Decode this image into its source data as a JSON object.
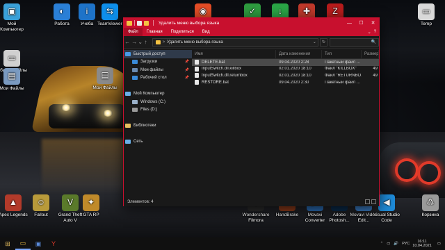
{
  "desktop_icons": [
    {
      "label": "Мой Компьютер",
      "color": "#3aa0d8",
      "glyph": "▣"
    },
    {
      "label": "Работа",
      "color": "#2a7fd6",
      "glyph": "◐"
    },
    {
      "label": "Учеба",
      "color": "#1e73c8",
      "glyph": "i"
    },
    {
      "label": "TeamViewer",
      "color": "#0e8ee9",
      "glyph": "⇆"
    },
    {
      "label": "Общие Файлы",
      "color": "#d0d0d0",
      "glyph": "▭"
    },
    {
      "label": "Мои Файлы",
      "color": "#7a9ac0",
      "glyph": "▤"
    },
    {
      "label": "",
      "color": "#e44d26",
      "glyph": "◉"
    },
    {
      "label": "",
      "color": "#2e9c3f",
      "glyph": "✓"
    },
    {
      "label": "",
      "color": "#2aa546",
      "glyph": "↓"
    },
    {
      "label": "",
      "color": "#c0392b",
      "glyph": "✚"
    },
    {
      "label": "",
      "color": "#b81c1c",
      "glyph": "Z"
    },
    {
      "label": "Temp",
      "color": "#d8d8d8",
      "glyph": "▭"
    },
    {
      "label": "Мои Файлы",
      "color": "#8a8a8a",
      "glyph": "▤"
    },
    {
      "label": "Apex Legends",
      "color": "#b23a2a",
      "glyph": "▲"
    },
    {
      "label": "Fallout",
      "color": "#b89a3a",
      "glyph": "☺"
    },
    {
      "label": "Grand Theft Auto V",
      "color": "#5a7a2a",
      "glyph": "V"
    },
    {
      "label": "GTA RP",
      "color": "#c08a2a",
      "glyph": "✦"
    },
    {
      "label": "Wondershare Filmora",
      "color": "#2a2a2a",
      "glyph": "◆"
    },
    {
      "label": "HandBrake",
      "color": "#8a3a1a",
      "glyph": "♨"
    },
    {
      "label": "Movavi Converter",
      "color": "#2a6ab0",
      "glyph": "▶"
    },
    {
      "label": "Adobe Photosh...",
      "color": "#0a2a4a",
      "glyph": "Ps"
    },
    {
      "label": "Movavi Video Edit...",
      "color": "#3a7ac0",
      "glyph": "▶"
    },
    {
      "label": "Visual Studio Code",
      "color": "#1e8ad6",
      "glyph": "◀"
    },
    {
      "label": "Корзина",
      "color": "#9a9a9a",
      "glyph": "♺"
    }
  ],
  "window": {
    "title": "Удалить меню выбора языка",
    "controls": {
      "minimize": "—",
      "maximize": "☐",
      "close": "✕"
    },
    "ribbon_tabs": [
      "Файл",
      "Главная",
      "Поделиться",
      "Вид"
    ],
    "ribbon_right": {
      "expand": "⌄",
      "help": "?"
    },
    "nav": {
      "back": "←",
      "forward": "→",
      "up_history": "⌄",
      "up": "↑"
    },
    "address": {
      "chevron": ">",
      "path": "Удалить меню выбора языка",
      "dropdown": "⌄",
      "refresh": "↻"
    },
    "search": {
      "icon": "🔍"
    },
    "nav_pane": [
      {
        "label": "Быстрый доступ",
        "icon_color": "#4a9ae8",
        "indent": 2,
        "selected": true
      },
      {
        "label": "Загрузки",
        "icon_color": "#3a8ad8",
        "indent": 12,
        "pin": "📌"
      },
      {
        "label": "Мои файлы",
        "icon_color": "#6a8ab0",
        "indent": 12,
        "pin": "📌"
      },
      {
        "label": "Рабочий стол",
        "icon_color": "#3a8ad8",
        "indent": 12,
        "pin": "📌"
      },
      {
        "label": "",
        "icon_color": "transparent",
        "indent": 2
      },
      {
        "label": "Мой Компьютер",
        "icon_color": "#6ab0e8",
        "indent": 2
      },
      {
        "label": "Windows (C:)",
        "icon_color": "#9ab0c8",
        "indent": 12
      },
      {
        "label": "Files (D:)",
        "icon_color": "#9a9a9a",
        "indent": 12
      },
      {
        "label": "",
        "icon_color": "transparent",
        "indent": 2
      },
      {
        "label": "Библиотеки",
        "icon_color": "#e8c060",
        "indent": 2
      },
      {
        "label": "",
        "icon_color": "transparent",
        "indent": 2
      },
      {
        "label": "Сеть",
        "icon_color": "#6ab0e8",
        "indent": 2
      }
    ],
    "columns": {
      "name": "Имя",
      "date": "Дата изменения",
      "type": "Тип",
      "size": "Размер"
    },
    "files": [
      {
        "name": "DELETE.bat",
        "date": "09.04.2020 2:28",
        "type": "Пакетный файл ...",
        "size": "",
        "selected": true
      },
      {
        "name": "InputSwitch.dll.killbox",
        "date": "02.01.2020 18:10",
        "type": "Файл \"KILLBOX\"",
        "size": "49"
      },
      {
        "name": "InputSwitch.dll.returnbox",
        "date": "02.01.2020 18:10",
        "type": "Файл \"RETURNBO...",
        "size": "49"
      },
      {
        "name": "RESTORE.bat",
        "date": "09.04.2020 2:30",
        "type": "Пакетный файл ...",
        "size": ""
      }
    ],
    "status": "Элементов: 4"
  },
  "taskbar": {
    "icons": [
      {
        "name": "start",
        "glyph": "⊞",
        "color": "#e8c060"
      },
      {
        "name": "explorer",
        "glyph": "▭",
        "color": "#f5c242",
        "active": true
      },
      {
        "name": "app",
        "glyph": "▣",
        "color": "#5a8ad8"
      },
      {
        "name": "yandex",
        "glyph": "Y",
        "color": "#e03a2a"
      }
    ],
    "tray": {
      "chevron": "⌃",
      "volume": "🔊",
      "network": "▭",
      "language": "РУС",
      "time": "16:11",
      "date": "10.04.2021",
      "notify": "▭"
    }
  }
}
